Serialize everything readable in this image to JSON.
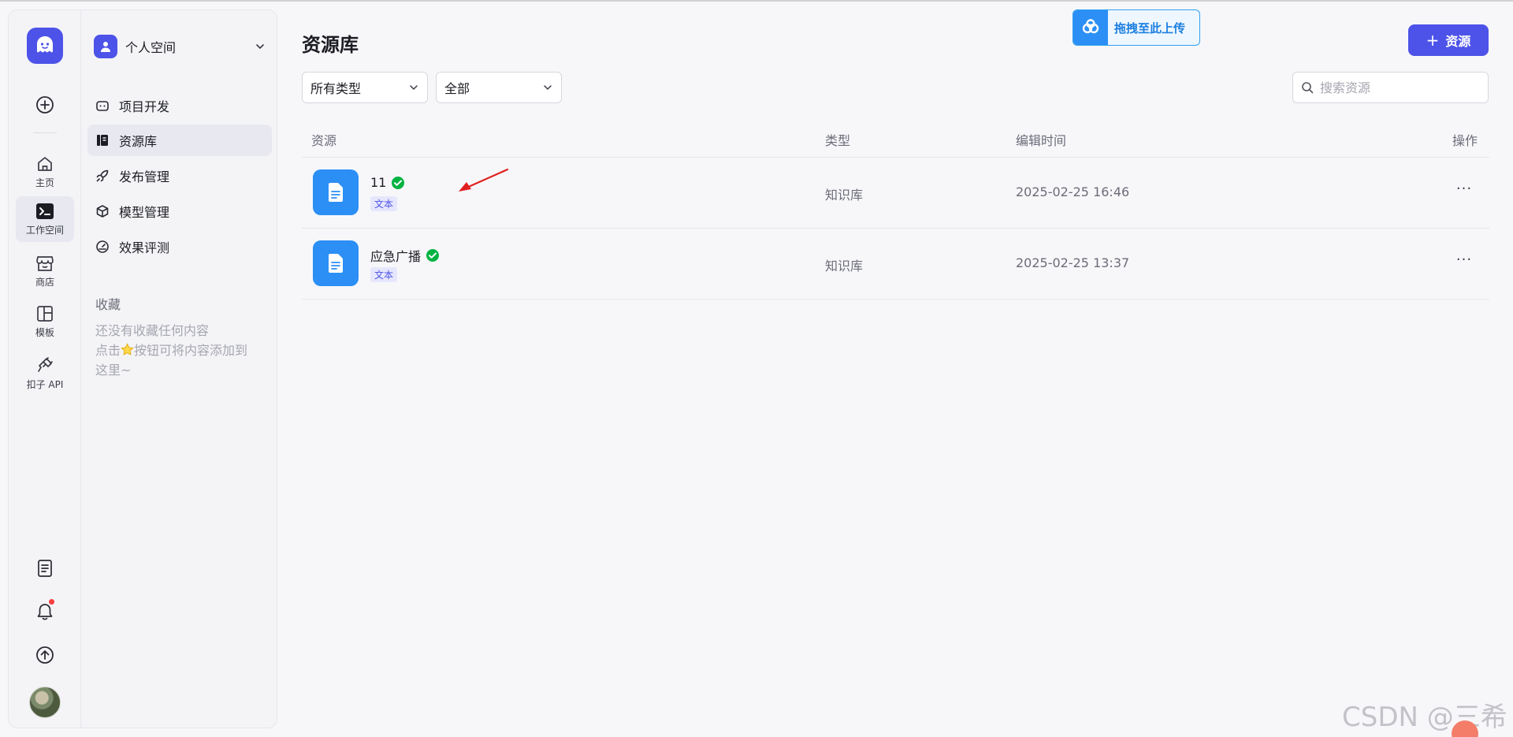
{
  "app": {
    "brand_color": "#4d53e8"
  },
  "rail": {
    "items": [
      {
        "key": "home",
        "label": "主页",
        "icon": "home-icon"
      },
      {
        "key": "workspace",
        "label": "工作空间",
        "icon": "terminal-icon",
        "active": true
      },
      {
        "key": "store",
        "label": "商店",
        "icon": "store-icon"
      },
      {
        "key": "template",
        "label": "模板",
        "icon": "template-icon"
      },
      {
        "key": "api",
        "label": "扣子 API",
        "icon": "plug-icon"
      }
    ],
    "bottom": [
      "docs-icon",
      "bell-icon",
      "upload-icon"
    ]
  },
  "sidebar": {
    "space_name": "个人空间",
    "nav": [
      {
        "label": "项目开发",
        "icon": "robot-icon"
      },
      {
        "label": "资源库",
        "icon": "library-icon",
        "active": true
      },
      {
        "label": "发布管理",
        "icon": "rocket-icon"
      },
      {
        "label": "模型管理",
        "icon": "cube-icon"
      },
      {
        "label": "效果评测",
        "icon": "gauge-icon"
      }
    ],
    "favorites_title": "收藏",
    "favorites_empty_line1": "还没有收藏任何内容",
    "favorites_empty_line2_pre": "点击",
    "favorites_empty_line2_post": "按钮可将内容添加到",
    "favorites_empty_line3": "这里~"
  },
  "main": {
    "title": "资源库",
    "add_button": "资源",
    "drop_upload": "拖拽至此上传",
    "filter_type": "所有类型",
    "filter_scope": "全部",
    "search_placeholder": "搜索资源",
    "columns": {
      "resource": "资源",
      "type": "类型",
      "edit_time": "编辑时间",
      "action": "操作"
    },
    "rows": [
      {
        "name": "11",
        "tag": "文本",
        "type": "知识库",
        "time": "2025-02-25 16:46",
        "more": "···"
      },
      {
        "name": "应急广播",
        "tag": "文本",
        "type": "知识库",
        "time": "2025-02-25 13:37",
        "more": "···"
      }
    ]
  },
  "watermark": "CSDN @三希"
}
